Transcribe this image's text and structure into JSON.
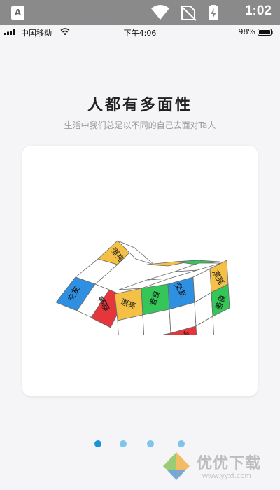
{
  "system_bar": {
    "time": "1:02",
    "app_icon_letter": "A"
  },
  "ios_status": {
    "carrier": "中国移动",
    "time": "下午4:06",
    "battery_percent": "98%"
  },
  "headline": {
    "title": "人都有多面性",
    "subtitle": "生活中我们总是以不同的自己去面对Ta人"
  },
  "cube_labels": {
    "beautiful": "漂亮",
    "kind": "善良",
    "friends": "交友",
    "smooth": "畅聊"
  },
  "pager": {
    "count": 4,
    "active_index": 0
  },
  "watermark": {
    "text": "优优下载",
    "url": "www.yyxt.com"
  },
  "colors": {
    "accent": "#1a93dd",
    "dot_inactive": "#7dc4ee",
    "cube_yellow": "#f4c046",
    "cube_green": "#34c659",
    "cube_blue": "#2f8fe0",
    "cube_red": "#e5363b"
  }
}
